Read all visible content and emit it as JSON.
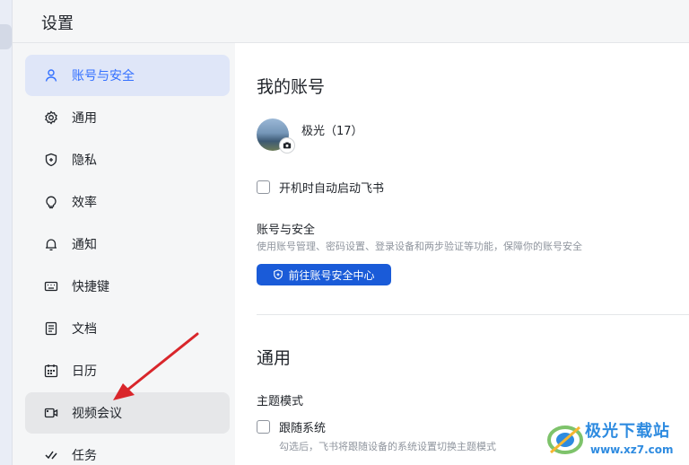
{
  "header": {
    "title": "设置"
  },
  "sidebar": {
    "items": [
      {
        "label": "账号与安全",
        "icon": "user-icon"
      },
      {
        "label": "通用",
        "icon": "gear-icon"
      },
      {
        "label": "隐私",
        "icon": "shield-icon"
      },
      {
        "label": "效率",
        "icon": "lightbulb-icon"
      },
      {
        "label": "通知",
        "icon": "bell-icon"
      },
      {
        "label": "快捷键",
        "icon": "keyboard-icon"
      },
      {
        "label": "文档",
        "icon": "document-icon"
      },
      {
        "label": "日历",
        "icon": "calendar-icon"
      },
      {
        "label": "视频会议",
        "icon": "video-icon"
      },
      {
        "label": "任务",
        "icon": "task-icon"
      }
    ]
  },
  "account": {
    "section_title": "我的账号",
    "username": "极光（17）",
    "autostart_label": "开机时自动启动飞书",
    "security_title": "账号与安全",
    "security_desc": "使用账号管理、密码设置、登录设备和两步验证等功能，保障你的账号安全",
    "security_button": "前往账号安全中心"
  },
  "general": {
    "section_title": "通用",
    "theme_title": "主题模式",
    "follow_system_label": "跟随系统",
    "follow_system_desc": "勾选后，飞书将跟随设备的系统设置切换主题模式"
  },
  "watermark": {
    "name": "极光下载站",
    "url": "www.xz7.com"
  },
  "colors": {
    "accent": "#3370ff",
    "button": "#1a5bd8",
    "annotation": "#d9262b"
  }
}
